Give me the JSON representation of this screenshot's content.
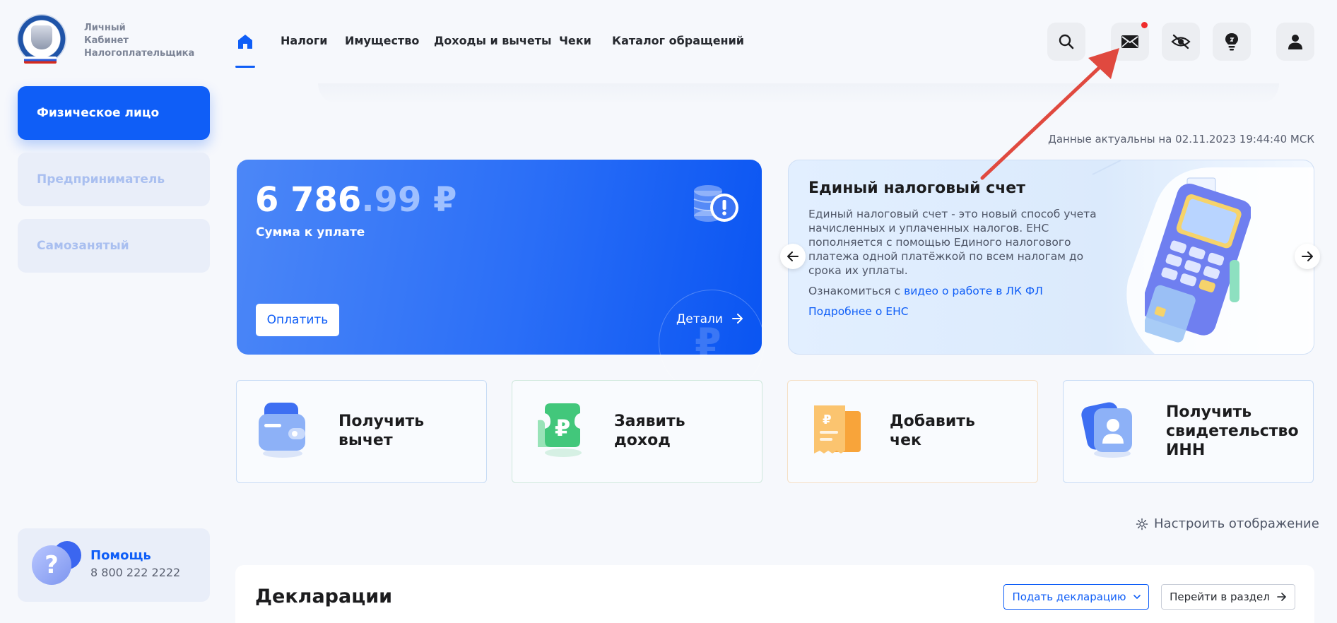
{
  "logo": {
    "lines": [
      "Личный",
      "Кабинет",
      "Налогоплательщика"
    ]
  },
  "nav": {
    "items": [
      "Налоги",
      "Имущество",
      "Доходы и вычеты",
      "Чеки",
      "Каталог обращений"
    ]
  },
  "sidebar": {
    "items": [
      "Физическое лицо",
      "Предприниматель",
      "Самозанятый"
    ],
    "help": {
      "title": "Помощь",
      "phone": "8 800 222 2222"
    }
  },
  "status": {
    "date_note": "Данные актуальны на 02.11.2023 19:44:40 МСК"
  },
  "payment": {
    "amount_int": "6 786",
    "amount_dec": ".99 ₽",
    "label": "Сумма к уплате",
    "pay_button": "Оплатить",
    "details": "Детали"
  },
  "ens": {
    "title": "Единый налоговый счет",
    "text": "Единый налоговый счет - это новый способ учета начисленных и уплаченных налогов. ЕНС пополняется с помощью Единого налогового платежа одной платёжкой по всем налогам до срока их уплаты.",
    "link_prefix": "Ознакомиться с ",
    "link_video": "видео о работе в ЛК ФЛ",
    "link_more": "Подробнее о ЕНС"
  },
  "actions": [
    {
      "line1": "Получить",
      "line2": "вычет",
      "line3": ""
    },
    {
      "line1": "Заявить",
      "line2": "доход",
      "line3": ""
    },
    {
      "line1": "Добавить",
      "line2": "чек",
      "line3": ""
    },
    {
      "line1": "Получить",
      "line2": "свидетельство",
      "line3": "ИНН"
    }
  ],
  "settings_label": "Настроить отображение",
  "declarations": {
    "title": "Декларации",
    "submit_button": "Подать декларацию",
    "goto_button": "Перейти в раздел"
  },
  "colors": {
    "accent": "#0f5ef7",
    "notification": "#ef2c2c",
    "annotation_arrow": "#e0493f"
  }
}
